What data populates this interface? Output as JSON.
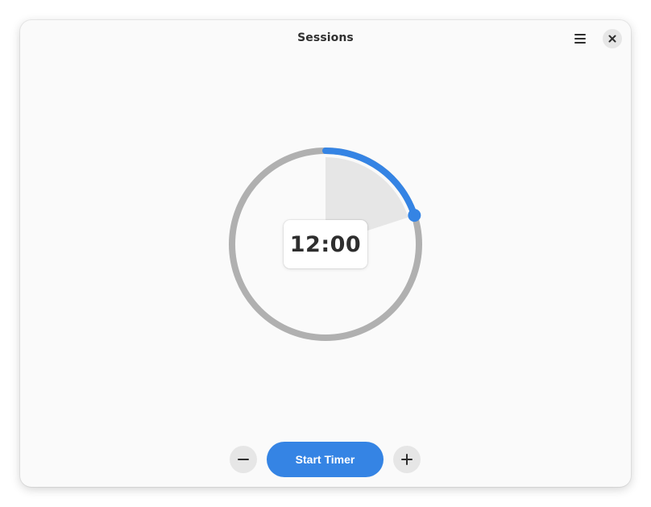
{
  "window": {
    "title": "Sessions"
  },
  "header": {
    "menu_icon": "hamburger-menu-icon",
    "close_icon": "close-icon"
  },
  "timer": {
    "display": "12:00",
    "progress_fraction": 0.2,
    "progress_color": "#3584e4",
    "track_color": "#b0b0b0"
  },
  "controls": {
    "decrease_icon": "minus-icon",
    "start_label": "Start Timer",
    "increase_icon": "plus-icon",
    "accent_color": "#3584e4"
  }
}
